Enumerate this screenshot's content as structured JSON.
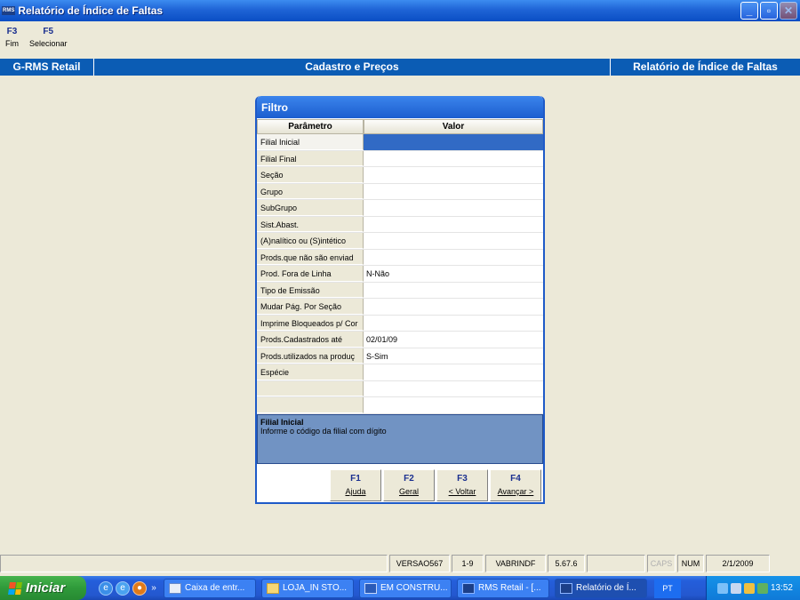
{
  "window": {
    "app_logo": "RMS",
    "title": "Relatório de Índice de Faltas",
    "buttons": {
      "minimize": "_",
      "maximize": "▫",
      "close": "✕"
    }
  },
  "toolbar": [
    {
      "key": "F3",
      "label": "Fim"
    },
    {
      "key": "F5",
      "label": "Selecionar"
    }
  ],
  "module_bar": {
    "left": "G-RMS Retail",
    "center": "Cadastro e Preços",
    "right": "Relatório de Índice de Faltas"
  },
  "dialog": {
    "title": "Filtro",
    "col_param": "Parâmetro",
    "col_value": "Valor",
    "rows": [
      {
        "param": "Filial Inicial",
        "value": ""
      },
      {
        "param": "Filial Final",
        "value": ""
      },
      {
        "param": "Seção",
        "value": ""
      },
      {
        "param": "Grupo",
        "value": ""
      },
      {
        "param": "SubGrupo",
        "value": ""
      },
      {
        "param": "Sist.Abast.",
        "value": ""
      },
      {
        "param": "(A)nalítico ou (S)intético",
        "value": ""
      },
      {
        "param": "Prods.que não são enviad",
        "value": ""
      },
      {
        "param": "Prod. Fora de Linha",
        "value": "N-Não"
      },
      {
        "param": "Tipo de Emissão",
        "value": ""
      },
      {
        "param": "Mudar Pág. Por Seção",
        "value": ""
      },
      {
        "param": "Imprime Bloqueados p/ Cor",
        "value": ""
      },
      {
        "param": "Prods.Cadastrados até",
        "value": "02/01/09"
      },
      {
        "param": "Prods.utilizados na produç",
        "value": "S-Sim"
      },
      {
        "param": "Espécie",
        "value": ""
      },
      {
        "param": "",
        "value": ""
      },
      {
        "param": "",
        "value": ""
      }
    ],
    "help_title": "Filial Inicial",
    "help_text": "Informe o código da filial com dígito",
    "buttons": [
      {
        "key": "F1",
        "label": "Ajuda"
      },
      {
        "key": "F2",
        "label": "Geral"
      },
      {
        "key": "F3",
        "label": "< Voltar"
      },
      {
        "key": "F4",
        "label": "Avançar >"
      }
    ]
  },
  "status_bar": {
    "version": "VERSAO567",
    "page": "1-9",
    "program": "VABRINDF",
    "build": "5.67.6",
    "caps": "CAPS",
    "num": "NUM",
    "date": "2/1/2009"
  },
  "taskbar": {
    "start_label": "Iniciar",
    "quicklaunch_more": "»",
    "tasks": [
      {
        "label": "Caixa de entr...",
        "icon": "outlook-icon"
      },
      {
        "label": "LOJA_IN STO...",
        "icon": "folder-icon"
      },
      {
        "label": "EM CONSTRU...",
        "icon": "word-icon"
      },
      {
        "label": "RMS Retail - [...",
        "icon": "rms-icon"
      },
      {
        "label": "Relatório de Í...",
        "icon": "rms-icon"
      }
    ],
    "language": "PT",
    "clock": "13:52"
  },
  "colors": {
    "title_bar": "#1f64d6",
    "module_bar": "#0b5cb4",
    "selection": "#316ac5",
    "help_panel": "#7193c3",
    "background": "#ece9d8",
    "start_green": "#2f9a3a"
  }
}
